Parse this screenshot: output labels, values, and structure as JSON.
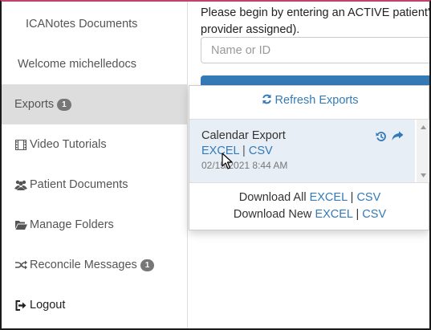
{
  "sidebar": {
    "title": "ICANotes Documents",
    "welcome": "Welcome michelledocs",
    "items": [
      {
        "label": "Exports",
        "badge": "1"
      },
      {
        "label": "Video Tutorials"
      },
      {
        "label": "Patient Documents"
      },
      {
        "label": "Manage Folders"
      },
      {
        "label": "Reconcile Messages",
        "badge": "1"
      },
      {
        "label": "Logout"
      }
    ]
  },
  "main": {
    "intro_line1": "Please begin by entering an ACTIVE patient's",
    "intro_line2": "provider assigned).",
    "search_placeholder": "Name or ID"
  },
  "exports_panel": {
    "refresh_label": "Refresh Exports",
    "item": {
      "name": "Calendar Export",
      "excel": "EXCEL",
      "sep": "|",
      "csv": "CSV",
      "timestamp": "02/15/2021 8:44 AM"
    },
    "download_all_label": "Download All",
    "download_new_label": "Download New",
    "excel": "EXCEL",
    "csv": "CSV",
    "sep": "|"
  },
  "colors": {
    "link": "#337ab7",
    "active_bg": "#dddddd",
    "badge": "#777777",
    "selected_item_bg": "#e8eef6"
  }
}
